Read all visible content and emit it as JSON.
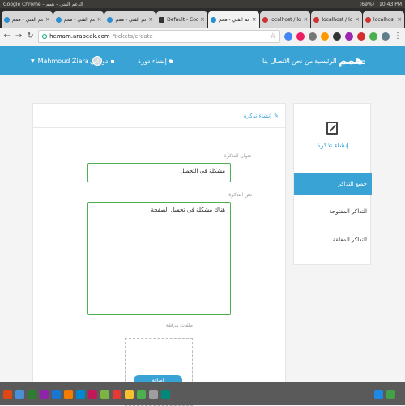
{
  "os_bar": {
    "title": "Google Chrome - الدعم الفني - همم",
    "battery": "(69%)",
    "time": "10:43 PM"
  },
  "tabs": [
    {
      "label": "الدعم الفني - همم",
      "icon": "hmm-logo-icon",
      "active": false
    },
    {
      "label": "الدعم الفني - همم",
      "icon": "hmm-logo-icon",
      "active": false
    },
    {
      "label": "الدعم الفني - همم",
      "icon": "hmm-logo-icon",
      "active": false
    },
    {
      "label": "Default - CodePen",
      "icon": "codepen-icon",
      "active": false
    },
    {
      "label": "الدعم الفني - همم",
      "icon": "hmm-logo-icon",
      "active": true
    },
    {
      "label": "localhost / local",
      "icon": "phpmyadmin-icon",
      "active": false
    },
    {
      "label": "localhost / local",
      "icon": "phpmyadmin-icon",
      "active": false
    },
    {
      "label": "localhost / local",
      "icon": "phpmyadmin-icon",
      "active": false
    }
  ],
  "address_bar": {
    "host": "hemam.arapeak.com",
    "path": "/tickets/create"
  },
  "header": {
    "logo": "همم",
    "nav": [
      "الرئيسية",
      "من نحن",
      "الاتصال بنا"
    ],
    "create_course": "إنشاء دورة",
    "my_courses": "دوراتي",
    "user_name": "Mahmoud Ziara"
  },
  "form": {
    "heading": "إنشاء تذكرة",
    "title_label": "عنوان التذكرة",
    "title_value": "مشكلة في التحميل",
    "body_label": "نص التذكرة",
    "body_value": "هناك مشكلة في تحميل الصفحة",
    "attachments_label": "ملفات مرفقة",
    "upload_label": "إضافة"
  },
  "sidebar": {
    "title": "إنشاء تذكرة",
    "items": [
      {
        "label": "جميع التذاكر",
        "active": true
      },
      {
        "label": "التذاكر المفتوحة",
        "active": false
      },
      {
        "label": "التذاكر المغلقة",
        "active": false
      }
    ]
  },
  "colors": {
    "brand": "#3aa3d6",
    "input_border": "#4caf50"
  }
}
